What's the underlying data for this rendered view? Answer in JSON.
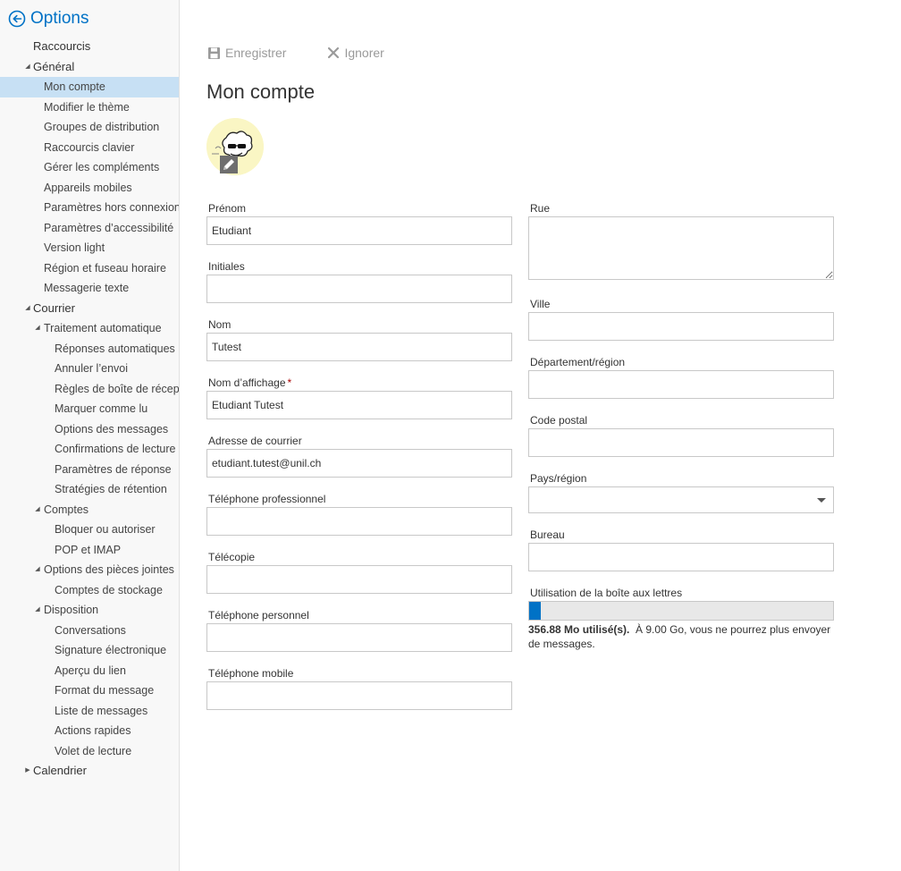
{
  "header": {
    "title": "Options"
  },
  "nav": [
    {
      "label": "Raccourcis",
      "level": 0,
      "toggle": ""
    },
    {
      "label": "Général",
      "level": 0,
      "toggle": "expanded"
    },
    {
      "label": "Mon compte",
      "level": 1,
      "toggle": "",
      "selected": true
    },
    {
      "label": "Modifier le thème",
      "level": 1,
      "toggle": ""
    },
    {
      "label": "Groupes de distribution",
      "level": 1,
      "toggle": ""
    },
    {
      "label": "Raccourcis clavier",
      "level": 1,
      "toggle": ""
    },
    {
      "label": "Gérer les compléments",
      "level": 1,
      "toggle": ""
    },
    {
      "label": "Appareils mobiles",
      "level": 1,
      "toggle": ""
    },
    {
      "label": "Paramètres hors connexion",
      "level": 1,
      "toggle": ""
    },
    {
      "label": "Paramètres d’accessibilité",
      "level": 1,
      "toggle": ""
    },
    {
      "label": "Version light",
      "level": 1,
      "toggle": ""
    },
    {
      "label": "Région et fuseau horaire",
      "level": 1,
      "toggle": ""
    },
    {
      "label": "Messagerie texte",
      "level": 1,
      "toggle": ""
    },
    {
      "label": "Courrier",
      "level": 0,
      "toggle": "expanded"
    },
    {
      "label": "Traitement automatique",
      "level": 1,
      "toggle": "expanded"
    },
    {
      "label": "Réponses automatiques",
      "level": 2,
      "toggle": ""
    },
    {
      "label": "Annuler l’envoi",
      "level": 2,
      "toggle": ""
    },
    {
      "label": "Règles de boîte de réception",
      "level": 2,
      "toggle": ""
    },
    {
      "label": "Marquer comme lu",
      "level": 2,
      "toggle": ""
    },
    {
      "label": "Options des messages",
      "level": 2,
      "toggle": ""
    },
    {
      "label": "Confirmations de lecture",
      "level": 2,
      "toggle": ""
    },
    {
      "label": "Paramètres de réponse",
      "level": 2,
      "toggle": ""
    },
    {
      "label": "Stratégies de rétention",
      "level": 2,
      "toggle": ""
    },
    {
      "label": "Comptes",
      "level": 1,
      "toggle": "expanded"
    },
    {
      "label": "Bloquer ou autoriser",
      "level": 2,
      "toggle": ""
    },
    {
      "label": "POP et IMAP",
      "level": 2,
      "toggle": ""
    },
    {
      "label": "Options des pièces jointes",
      "level": 1,
      "toggle": "expanded"
    },
    {
      "label": "Comptes de stockage",
      "level": 2,
      "toggle": ""
    },
    {
      "label": "Disposition",
      "level": 1,
      "toggle": "expanded"
    },
    {
      "label": "Conversations",
      "level": 2,
      "toggle": ""
    },
    {
      "label": "Signature électronique",
      "level": 2,
      "toggle": ""
    },
    {
      "label": "Aperçu du lien",
      "level": 2,
      "toggle": ""
    },
    {
      "label": "Format du message",
      "level": 2,
      "toggle": ""
    },
    {
      "label": "Liste de messages",
      "level": 2,
      "toggle": ""
    },
    {
      "label": "Actions rapides",
      "level": 2,
      "toggle": ""
    },
    {
      "label": "Volet de lecture",
      "level": 2,
      "toggle": ""
    },
    {
      "label": "Calendrier",
      "level": 0,
      "toggle": "collapsed"
    }
  ],
  "toolbar": {
    "save_label": "Enregistrer",
    "ignore_label": "Ignorer"
  },
  "page": {
    "title": "Mon compte"
  },
  "form": {
    "first_name": {
      "label": "Prénom",
      "value": "Etudiant"
    },
    "initials": {
      "label": "Initiales",
      "value": ""
    },
    "last_name": {
      "label": "Nom",
      "value": "Tutest"
    },
    "display_name": {
      "label": "Nom d’affichage",
      "required_mark": "*",
      "value": "Etudiant Tutest"
    },
    "email": {
      "label": "Adresse de courrier",
      "value": "etudiant.tutest@unil.ch"
    },
    "work_phone": {
      "label": "Téléphone professionnel",
      "value": ""
    },
    "fax": {
      "label": "Télécopie",
      "value": ""
    },
    "home_phone": {
      "label": "Téléphone personnel",
      "value": ""
    },
    "mobile_phone": {
      "label": "Téléphone mobile",
      "value": ""
    },
    "street": {
      "label": "Rue",
      "value": ""
    },
    "city": {
      "label": "Ville",
      "value": ""
    },
    "state": {
      "label": "Département/région",
      "value": ""
    },
    "postal_code": {
      "label": "Code postal",
      "value": ""
    },
    "country": {
      "label": "Pays/région",
      "value": ""
    },
    "office": {
      "label": "Bureau",
      "value": ""
    }
  },
  "mailbox": {
    "label": "Utilisation de la boîte aux lettres",
    "used": "356.88 Mo utilisé(s).",
    "note": "À 9.00 Go, vous ne pourrez plus envoyer de messages.",
    "fraction": 0.039
  },
  "colors": {
    "accent": "#0072c6",
    "selected": "#c7e0f4",
    "required": "#a80000"
  }
}
